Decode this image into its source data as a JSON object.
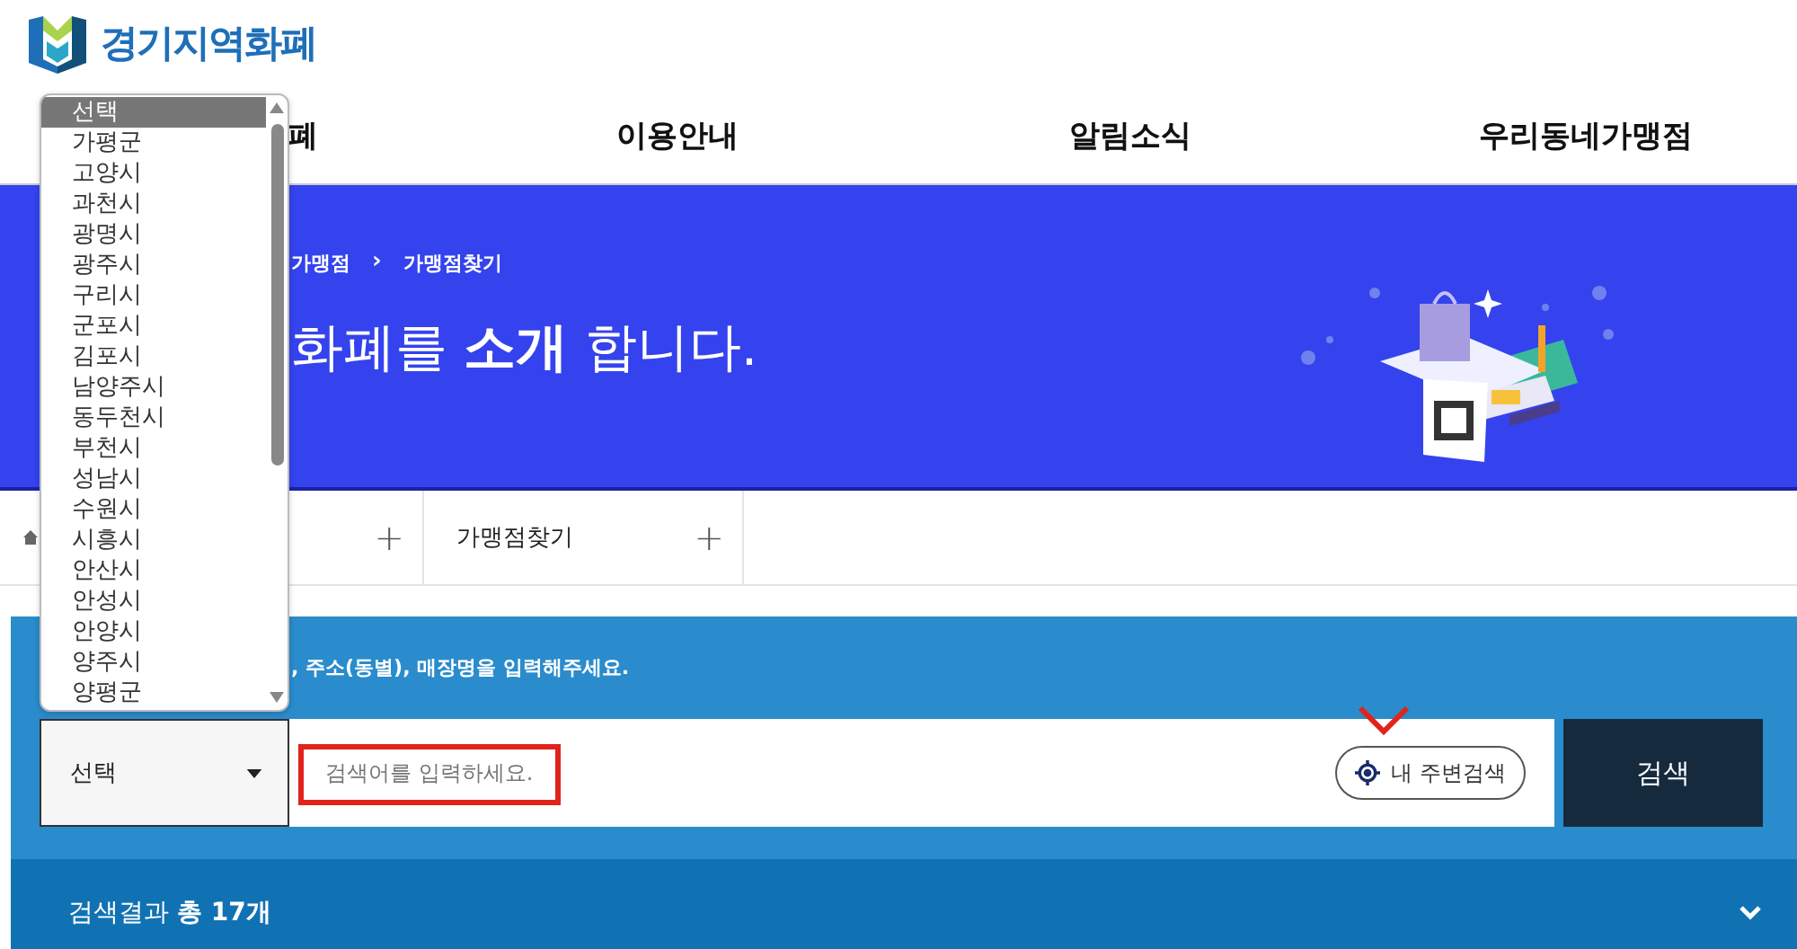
{
  "logo": {
    "text": "경기지역화폐"
  },
  "nav": [
    {
      "label": "폐"
    },
    {
      "label": "이용안내"
    },
    {
      "label": "알림소식"
    },
    {
      "label": "우리동네가맹점"
    }
  ],
  "banner": {
    "breadcrumb": [
      "가맹점",
      "›",
      "가맹점찾기"
    ],
    "title": "화폐를 **소개** 합니다."
  },
  "tabs": [
    {
      "expand": "+"
    },
    {
      "label": "가맹점찾기",
      "expand": "+"
    }
  ],
  "search": {
    "hint": ", 주소(동별), 매장명을 입력해주세요.",
    "region_select": "선택",
    "placeholder": "검색어를 입력하세요.",
    "nearby_button": "내 주변검색",
    "search_button": "검색"
  },
  "dropdown": {
    "options": [
      {
        "label": "선택",
        "selected": true
      },
      {
        "label": "가평군",
        "selected": false
      },
      {
        "label": "고양시",
        "selected": false
      },
      {
        "label": "과천시",
        "selected": false
      },
      {
        "label": "광명시",
        "selected": false
      },
      {
        "label": "광주시",
        "selected": false
      },
      {
        "label": "구리시",
        "selected": false
      },
      {
        "label": "군포시",
        "selected": false
      },
      {
        "label": "김포시",
        "selected": false
      },
      {
        "label": "남양주시",
        "selected": false
      },
      {
        "label": "동두천시",
        "selected": false
      },
      {
        "label": "부천시",
        "selected": false
      },
      {
        "label": "성남시",
        "selected": false
      },
      {
        "label": "수원시",
        "selected": false
      },
      {
        "label": "시흥시",
        "selected": false
      },
      {
        "label": "안산시",
        "selected": false
      },
      {
        "label": "안성시",
        "selected": false
      },
      {
        "label": "안양시",
        "selected": false
      },
      {
        "label": "양주시",
        "selected": false
      },
      {
        "label": "양평군",
        "selected": false
      }
    ]
  },
  "results": {
    "summary": "검색결과 **총 17개**"
  }
}
